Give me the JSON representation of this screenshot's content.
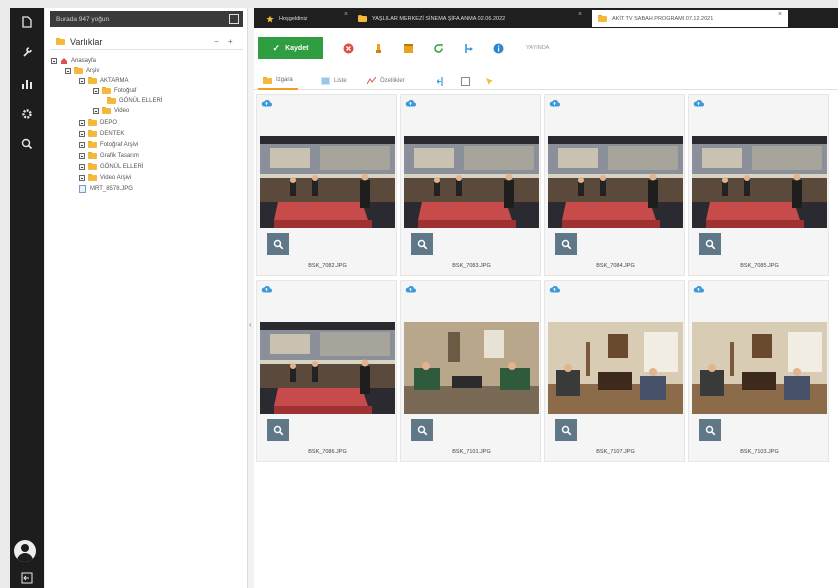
{
  "tree": {
    "search_value": "Burada 947 yoğun",
    "title": "Varlıklar",
    "collapse_label": "−",
    "expand_label": "+",
    "items": [
      {
        "label": "Anasayfa"
      },
      {
        "label": "Arşiv"
      },
      {
        "label": "AKTARMA"
      },
      {
        "label": "Fotoğraf"
      },
      {
        "label": "GÖNÜL ELLERİ"
      },
      {
        "label": "Video"
      },
      {
        "label": "DEPO"
      },
      {
        "label": "DENTEK"
      },
      {
        "label": "Fotoğraf Arşivi"
      },
      {
        "label": "Grafik Tasarım"
      },
      {
        "label": "GÖNÜL ELLERİ"
      },
      {
        "label": "Video Arşivi"
      },
      {
        "label": "MRT_8578.JPG"
      }
    ]
  },
  "tabs": [
    {
      "label": "Hoşgeldiniz"
    },
    {
      "label": "YAŞLILAR MERKEZİ SİNEMA ŞİFA ANMA 02.06.2022"
    },
    {
      "label": "AKİT TV SABAH PROGRAMI 07.12.2021"
    }
  ],
  "toolbar": {
    "save_label": "Kaydet",
    "status_text": "YAYINDA"
  },
  "view_tabs": [
    {
      "label": "Izgara"
    },
    {
      "label": "Liste"
    },
    {
      "label": "Özellikler"
    }
  ],
  "files": [
    {
      "name": "BSK_7082.JPG"
    },
    {
      "name": "BSK_7083.JPG"
    },
    {
      "name": "BSK_7084.JPG"
    },
    {
      "name": "BSK_7085.JPG"
    },
    {
      "name": "BSK_7086.JPG"
    },
    {
      "name": "BSK_7101.JPG"
    },
    {
      "name": "BSK_7107.JPG"
    },
    {
      "name": "BSK_7103.JPG"
    }
  ],
  "colors": {
    "accent_green": "#2e9e40",
    "folder_yellow": "#f4b93a",
    "zoom_button": "#607787",
    "cloud_blue": "#3b9ad9",
    "rail_dark": "#1d1d1d"
  }
}
